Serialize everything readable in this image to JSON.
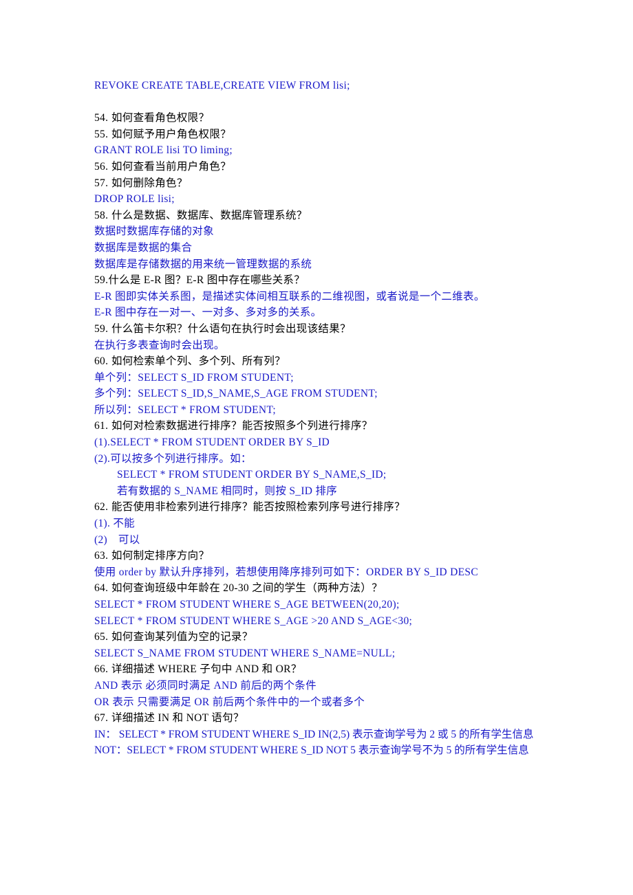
{
  "document": {
    "title": "SQL 题库答案文档",
    "colors": {
      "question_text": "#000000",
      "answer_text": "#1a1ac8",
      "page_background": "#ffffff"
    },
    "lines": [
      {
        "id": "l01",
        "kind": "answer",
        "text": "REVOKE CREATE TABLE,CREATE VIEW FROM lisi;"
      },
      {
        "id": "l02",
        "kind": "spacer",
        "text": ""
      },
      {
        "id": "l03",
        "kind": "question",
        "number": "54.",
        "text": "如何查看角色权限？"
      },
      {
        "id": "l04",
        "kind": "question",
        "number": "55.",
        "text": "如何赋予用户角色权限？"
      },
      {
        "id": "l05",
        "kind": "answer",
        "text": "GRANT ROLE lisi TO liming;"
      },
      {
        "id": "l06",
        "kind": "question",
        "number": "56.",
        "text": "如何查看当前用户角色？"
      },
      {
        "id": "l07",
        "kind": "question",
        "number": "57.",
        "text": "如何删除角色？"
      },
      {
        "id": "l08",
        "kind": "answer",
        "text": "DROP ROLE lisi;"
      },
      {
        "id": "l09",
        "kind": "question",
        "number": "58.",
        "text": "什么是数据、数据库、数据库管理系统？"
      },
      {
        "id": "l10",
        "kind": "answer",
        "text": "数据时数据库存储的对象"
      },
      {
        "id": "l11",
        "kind": "answer",
        "text": "数据库是数据的集合"
      },
      {
        "id": "l12",
        "kind": "answer",
        "text": "数据库是存储数据的用来统一管理数据的系统"
      },
      {
        "id": "l13",
        "kind": "question-tight",
        "number": "59.",
        "text": "什么是 E-R 图？E-R 图中存在哪些关系？"
      },
      {
        "id": "l14",
        "kind": "answer",
        "text": "E-R 图即实体关系图，是描述实体间相互联系的二维视图，或者说是一个二维表。"
      },
      {
        "id": "l15",
        "kind": "answer",
        "text": "E-R 图中存在一对一、一对多、多对多的关系。"
      },
      {
        "id": "l16",
        "kind": "question",
        "number": "59.",
        "text": "什么笛卡尔积？什么语句在执行时会出现该结果？"
      },
      {
        "id": "l17",
        "kind": "answer",
        "text": "在执行多表查询时会出现。"
      },
      {
        "id": "l18",
        "kind": "question",
        "number": "60.",
        "text": "如何检索单个列、多个列、所有列？"
      },
      {
        "id": "l19",
        "kind": "answer",
        "text": "单个列：SELECT S_ID FROM STUDENT;"
      },
      {
        "id": "l20",
        "kind": "answer",
        "text": "多个列：SELECT S_ID,S_NAME,S_AGE FROM STUDENT;"
      },
      {
        "id": "l21",
        "kind": "answer",
        "text": "所以列：SELECT * FROM STUDENT;"
      },
      {
        "id": "l22",
        "kind": "question",
        "number": "61.",
        "text": "如何对检索数据进行排序？能否按照多个列进行排序？"
      },
      {
        "id": "l23",
        "kind": "answer",
        "text": "(1).SELECT * FROM STUDENT ORDER BY S_ID"
      },
      {
        "id": "l24",
        "kind": "answer",
        "text": "(2).可以按多个列进行排序。如："
      },
      {
        "id": "l25",
        "kind": "answer-indent",
        "text": "SELECT * FROM STUDENT ORDER BY S_NAME,S_ID;"
      },
      {
        "id": "l26",
        "kind": "answer-indent",
        "text": "若有数据的 S_NAME 相同时，则按 S_ID 排序"
      },
      {
        "id": "l27",
        "kind": "question",
        "number": "62.",
        "text": "能否使用非检索列进行排序？能否按照检索列序号进行排序？"
      },
      {
        "id": "l28",
        "kind": "answer",
        "text": "(1). 不能"
      },
      {
        "id": "l29",
        "kind": "answer",
        "text": "(2)　可以"
      },
      {
        "id": "l30",
        "kind": "question",
        "number": "63.",
        "text": "如何制定排序方向？"
      },
      {
        "id": "l31",
        "kind": "answer",
        "text": "使用 order by 默认升序排列，若想使用降序排列可如下：ORDER BY S_ID DESC"
      },
      {
        "id": "l32",
        "kind": "question",
        "number": "64.",
        "text": "如何查询班级中年龄在 20-30 之间的学生（两种方法）？"
      },
      {
        "id": "l33",
        "kind": "answer",
        "text": "SELECT * FROM STUDENT WHERE S_AGE BETWEEN(20,20);"
      },
      {
        "id": "l34",
        "kind": "answer",
        "text": "SELECT * FROM STUDENT WHERE S_AGE >20 AND S_AGE<30;"
      },
      {
        "id": "l35",
        "kind": "question",
        "number": "65.",
        "text": "如何查询某列值为空的记录？"
      },
      {
        "id": "l36",
        "kind": "answer",
        "text": "SELECT S_NAME FROM STUDENT WHERE S_NAME=NULL;"
      },
      {
        "id": "l37",
        "kind": "question",
        "number": "66.",
        "text": "详细描述 WHERE 子句中 AND 和 OR？"
      },
      {
        "id": "l38",
        "kind": "answer",
        "text": "AND 表示 必须同时满足 AND 前后的两个条件"
      },
      {
        "id": "l39",
        "kind": "answer",
        "text": "OR 表示 只需要满足 OR 前后两个条件中的一个或者多个"
      },
      {
        "id": "l40",
        "kind": "question",
        "number": "67.",
        "text": "详细描述 IN 和 NOT 语句？"
      },
      {
        "id": "l41",
        "kind": "answer-wrap",
        "text": "IN：  SELECT * FROM STUDENT WHERE S_ID IN(2,5) 表示查询学号为 2 或 5 的所有学生信息"
      },
      {
        "id": "l42",
        "kind": "answer-wrap",
        "text": "NOT：SELECT * FROM STUDENT WHERE S_ID NOT 5 表示查询学号不为 5 的所有学生信息"
      }
    ]
  }
}
